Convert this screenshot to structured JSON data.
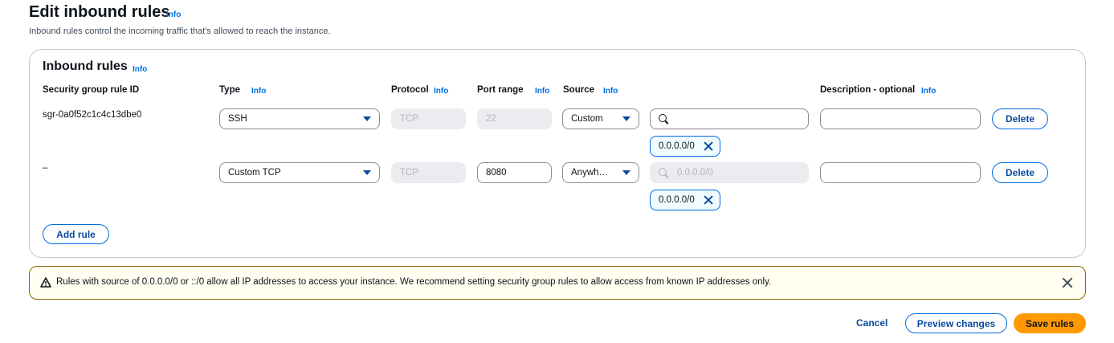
{
  "page": {
    "title": "Edit inbound rules",
    "info": "Info",
    "description": "Inbound rules control the incoming traffic that's allowed to reach the instance."
  },
  "panel": {
    "title": "Inbound rules",
    "info": "Info",
    "columns": {
      "rule_id": "Security group rule ID",
      "type": "Type",
      "protocol": "Protocol",
      "port_range": "Port range",
      "source": "Source",
      "description": "Description - optional"
    },
    "rows": [
      {
        "rule_id": "sgr-0a0f52c1c4c13dbe0",
        "type": "SSH",
        "protocol": "TCP",
        "port_range": "22",
        "source": "Custom",
        "search_value": "",
        "search_placeholder": "",
        "token": "0.0.0.0/0",
        "description": "",
        "delete_label": "Delete"
      },
      {
        "rule_id": "–",
        "type": "Custom TCP",
        "protocol": "TCP",
        "port_range": "8080",
        "source": "Anywh…",
        "search_value": "",
        "search_placeholder": "0.0.0.0/0",
        "token": "0.0.0.0/0",
        "description": "",
        "delete_label": "Delete"
      }
    ],
    "add_rule_label": "Add rule"
  },
  "alert": {
    "icon": "warning-icon",
    "text": "Rules with source of 0.0.0.0/0 or ::/0 allow all IP addresses to access your instance. We recommend setting security group rules to allow access from known IP addresses only."
  },
  "footer": {
    "cancel_label": "Cancel",
    "preview_label": "Preview changes",
    "save_label": "Save rules"
  },
  "colors": {
    "link": "#006ce0",
    "primary": "#ff9900",
    "alert_border": "#8d6605",
    "alert_bg": "#fffef0"
  }
}
